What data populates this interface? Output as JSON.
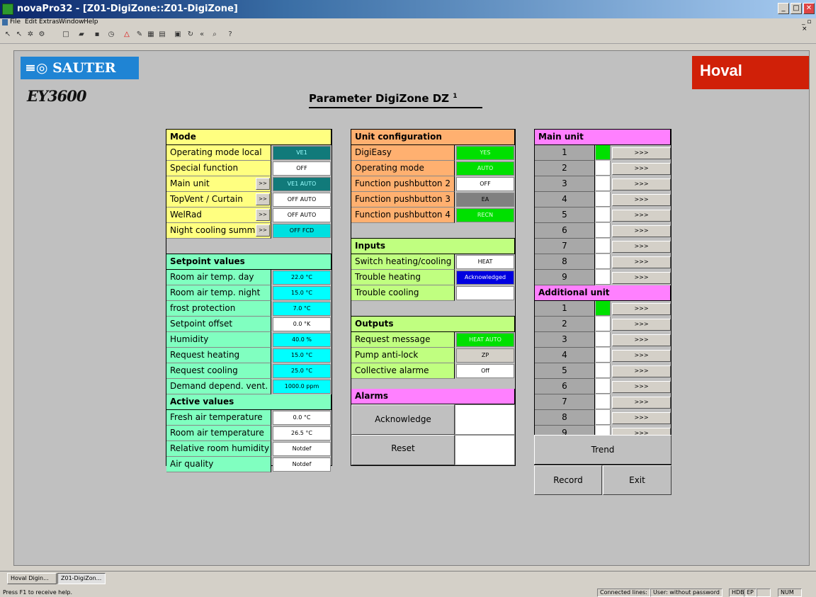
{
  "window": {
    "title": "novaPro32   - [Z01-DigiZone::Z01-DigiZone]"
  },
  "menu": [
    "File",
    "Edit",
    "Extras",
    "Window",
    "Help"
  ],
  "logos": {
    "sauter": "SAUTER",
    "ey": "EY3600",
    "hoval": "Hoval"
  },
  "page_title": "Parameter DigiZone  DZ",
  "page_title_sup": "1",
  "mode": {
    "header": "Mode",
    "rows": [
      {
        "label": "Operating mode local",
        "value": "VE1",
        "bg": "#117a7a",
        "fg": "#9ff"
      },
      {
        "label": "Special function",
        "value": "OFF",
        "bg": "#ffffff",
        "fg": "#000"
      },
      {
        "label": "Main unit",
        "value": "VE1 AUTO",
        "bg": "#117a7a",
        "fg": "#9ff",
        "btn": ">>"
      },
      {
        "label": "TopVent  / Curtain",
        "value": "OFF AUTO",
        "bg": "#ffffff",
        "fg": "#000",
        "btn": ">>"
      },
      {
        "label": "WelRad",
        "value": "OFF AUTO",
        "bg": "#ffffff",
        "fg": "#000",
        "btn": ">>"
      },
      {
        "label": "Night cooling summe",
        "value": "OFF FCD",
        "bg": "#00e0e0",
        "fg": "#000",
        "btn": ">>"
      }
    ]
  },
  "setpoints": {
    "header": "Setpoint values",
    "rows": [
      {
        "label": "Room air temp. day",
        "value": "22.0 °C",
        "bg": "#00ffff"
      },
      {
        "label": "Room air temp. night",
        "value": "15.0 °C",
        "bg": "#00ffff"
      },
      {
        "label": "frost protection",
        "value": "7.0 °C",
        "bg": "#00ffff"
      },
      {
        "label": "Setpoint offset",
        "value": "0.0 °K",
        "bg": "#ffffff"
      },
      {
        "label": "Humidity",
        "value": "40.0 %",
        "bg": "#00ffff"
      },
      {
        "label": "Request heating",
        "value": "15.0 °C",
        "bg": "#00ffff"
      },
      {
        "label": "Request cooling",
        "value": "25.0 °C",
        "bg": "#00ffff"
      },
      {
        "label": "Demand depend. vent.",
        "value": "1000.0 ppm",
        "bg": "#00ffff"
      }
    ]
  },
  "active": {
    "header": "Active values",
    "rows": [
      {
        "label": "Fresh air temperature",
        "value": "0.0 °C"
      },
      {
        "label": "Room air temperature",
        "value": "26.5 °C"
      },
      {
        "label": "Relative room humidity",
        "value": "Notdef"
      },
      {
        "label": "Air quality",
        "value": "Notdef"
      }
    ]
  },
  "unit_config": {
    "header": "Unit configuration",
    "rows": [
      {
        "label": "DigiEasy",
        "value": "YES",
        "bg": "#00e000",
        "fg": "#dfd"
      },
      {
        "label": "Operating mode",
        "value": "AUTO",
        "bg": "#00e000",
        "fg": "#dfd"
      },
      {
        "label": "Function pushbutton 2",
        "value": "OFF",
        "bg": "#ffffff",
        "fg": "#000"
      },
      {
        "label": "Function pushbutton 3",
        "value": "EA",
        "bg": "#808080",
        "fg": "#000"
      },
      {
        "label": "Function pushbutton 4",
        "value": "RECN",
        "bg": "#00e000",
        "fg": "#dfd"
      }
    ]
  },
  "inputs": {
    "header": "Inputs",
    "rows": [
      {
        "label": "Switch heating/cooling",
        "value": "HEAT",
        "bg": "#ffffff",
        "fg": "#000"
      },
      {
        "label": "Trouble heating",
        "value": "Acknowledged",
        "bg": "#0000e0",
        "fg": "#fff"
      },
      {
        "label": "Trouble cooling",
        "value": "",
        "bg": "#ffffff",
        "fg": "#000"
      }
    ]
  },
  "outputs": {
    "header": "Outputs",
    "rows": [
      {
        "label": "Request message",
        "value": "HEAT AUTO",
        "bg": "#00e000",
        "fg": "#dfd"
      },
      {
        "label": "Pump anti-lock",
        "value": "ZP",
        "bg": "#d4d0c8",
        "fg": "#000"
      },
      {
        "label": "Collective alarme",
        "value": "Off",
        "bg": "#ffffff",
        "fg": "#000"
      }
    ]
  },
  "alarms": {
    "header": "Alarms",
    "acknowledge": "Acknowledge",
    "reset": "Reset"
  },
  "main_unit": {
    "header": "Main unit",
    "rows": [
      {
        "n": "1",
        "active": true
      },
      {
        "n": "2",
        "active": false
      },
      {
        "n": "3",
        "active": false
      },
      {
        "n": "4",
        "active": false
      },
      {
        "n": "5",
        "active": false
      },
      {
        "n": "6",
        "active": false
      },
      {
        "n": "7",
        "active": false
      },
      {
        "n": "8",
        "active": false
      },
      {
        "n": "9",
        "active": false
      }
    ],
    "btn": ">>>"
  },
  "additional_unit": {
    "header": "Additional unit",
    "rows": [
      {
        "n": "1",
        "active": true
      },
      {
        "n": "2",
        "active": false
      },
      {
        "n": "3",
        "active": false
      },
      {
        "n": "4",
        "active": false
      },
      {
        "n": "5",
        "active": false
      },
      {
        "n": "6",
        "active": false
      },
      {
        "n": "7",
        "active": false
      },
      {
        "n": "8",
        "active": false
      },
      {
        "n": "9",
        "active": false
      }
    ],
    "btn": ">>>"
  },
  "buttons": {
    "trend": "Trend",
    "record": "Record",
    "exit": "Exit"
  },
  "taskbar": [
    "Hoval Digin...",
    "Z01-DigiZon..."
  ],
  "status": {
    "help": "Press F1 to receive help.",
    "connected": "Connected lines:",
    "user": "User:  without password",
    "hdb": "HDB",
    "ep": "EP",
    "num": "NUM"
  }
}
